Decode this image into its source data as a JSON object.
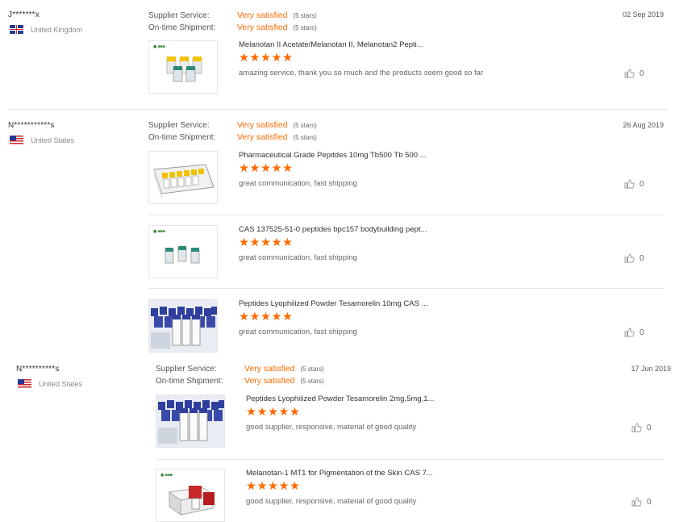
{
  "reviews": [
    {
      "buyer": "J*******x",
      "country": "United Kingdom",
      "flag": "uk-flag-icon",
      "date": "02 Sep 2019",
      "supplier_label": "Supplier Service:",
      "supplier_value": "Very satisfied",
      "supplier_stars": "(5 stars)",
      "shipment_label": "On-time Shipment:",
      "shipment_value": "Very satisfied",
      "shipment_stars": "(5 stars)",
      "products": [
        {
          "title": "Melanotan II Acetate/Melanotan II, Melanotan2 Pepti...",
          "stars": "★★★★★",
          "comment": "amazing service, thank you so much and the products seem good so far",
          "likes": "0",
          "image": "vials-image"
        }
      ]
    },
    {
      "buyer": "N***********s",
      "country": "United States",
      "flag": "us-flag-icon",
      "date": "26 Aug 2019",
      "supplier_label": "Supplier Service:",
      "supplier_value": "Very satisfied",
      "supplier_stars": "(5 stars)",
      "shipment_label": "On-time Shipment:",
      "shipment_value": "Very satisfied",
      "shipment_stars": "(5 stars)",
      "products": [
        {
          "title": "Pharmaceutical Grade Pepitdes 10mg Tb500 Tb 500 ...",
          "stars": "★★★★★",
          "comment": "great communication, fast shipping",
          "likes": "0",
          "image": "box-vials-image"
        },
        {
          "title": "CAS 137525-51-0 peptides bpc157 bodybuilding pept...",
          "stars": "★★★★★",
          "comment": "great communication, fast shipping",
          "likes": "0",
          "image": "vials-image"
        },
        {
          "title": "Peptides Lyophilized Powder Tesamorelin 10mg CAS ...",
          "stars": "★★★★★",
          "comment": "great communication, fast shipping",
          "likes": "0",
          "image": "blue-caps-image"
        }
      ]
    },
    {
      "buyer": "N**********s",
      "country": "United States",
      "flag": "us-flag-icon",
      "date": "17 Jun 2019",
      "supplier_label": "Supplier Service:",
      "supplier_value": "Very satisfied",
      "supplier_stars": "(5 stars)",
      "shipment_label": "On-time Shipment:",
      "shipment_value": "Very satisfied",
      "shipment_stars": "(5 stars)",
      "products": [
        {
          "title": "Peptides Lyophilized Powder Tesamorelin 2mg,5mg,1...",
          "stars": "★★★★★",
          "comment": "good supplier, responsive, material of good quality",
          "likes": "0",
          "image": "blue-caps-image"
        },
        {
          "title": "Melanotan-1 MT1 for Pigmentation of the Skin CAS 7...",
          "stars": "★★★★★",
          "comment": "good supplier, responsive, material of good quality",
          "likes": "0",
          "image": "red-box-image"
        }
      ]
    }
  ],
  "colors": {
    "accent": "#ff6a00",
    "divider": "#e8e8e8"
  }
}
